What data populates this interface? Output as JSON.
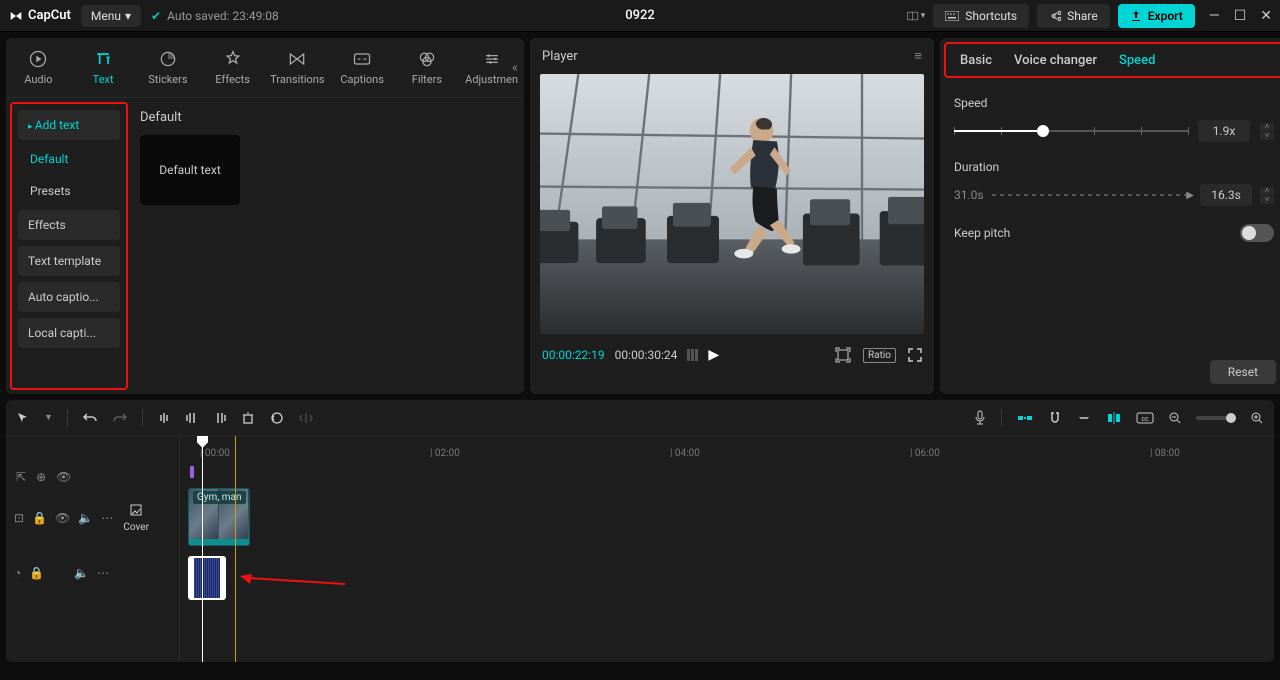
{
  "topbar": {
    "app_name": "CapCut",
    "menu_label": "Menu",
    "autosave_label": "Auto saved: 23:49:08",
    "project_title": "0922",
    "shortcuts_label": "Shortcuts",
    "share_label": "Share",
    "export_label": "Export"
  },
  "media_tabs": {
    "items": [
      {
        "label": "Audio"
      },
      {
        "label": "Text"
      },
      {
        "label": "Stickers"
      },
      {
        "label": "Effects"
      },
      {
        "label": "Transitions"
      },
      {
        "label": "Captions"
      },
      {
        "label": "Filters"
      },
      {
        "label": "Adjustmen"
      }
    ]
  },
  "text_sidebar": {
    "items": [
      {
        "label": "Add text",
        "active": true,
        "nested": false
      },
      {
        "label": "Default",
        "active": true,
        "nested": true
      },
      {
        "label": "Presets",
        "active": false,
        "nested": true
      },
      {
        "label": "Effects",
        "active": false,
        "nested": false
      },
      {
        "label": "Text template",
        "active": false,
        "nested": false
      },
      {
        "label": "Auto captio...",
        "active": false,
        "nested": false
      },
      {
        "label": "Local capti...",
        "active": false,
        "nested": false
      }
    ]
  },
  "text_content": {
    "section_title": "Default",
    "thumb_label": "Default text"
  },
  "player": {
    "title": "Player",
    "current_time": "00:00:22:19",
    "duration": "00:00:30:24",
    "ratio_label": "Ratio"
  },
  "inspector": {
    "tabs": [
      {
        "label": "Basic"
      },
      {
        "label": "Voice changer"
      },
      {
        "label": "Speed",
        "active": true
      }
    ],
    "speed_label": "Speed",
    "speed_value": "1.9x",
    "duration_label": "Duration",
    "duration_from": "31.0s",
    "duration_value": "16.3s",
    "keep_pitch_label": "Keep pitch",
    "reset_label": "Reset"
  },
  "timeline": {
    "ruler": [
      "00:00",
      "02:00",
      "04:00",
      "06:00",
      "08:00"
    ],
    "cover_label": "Cover",
    "clip_label": "Gym, man"
  }
}
